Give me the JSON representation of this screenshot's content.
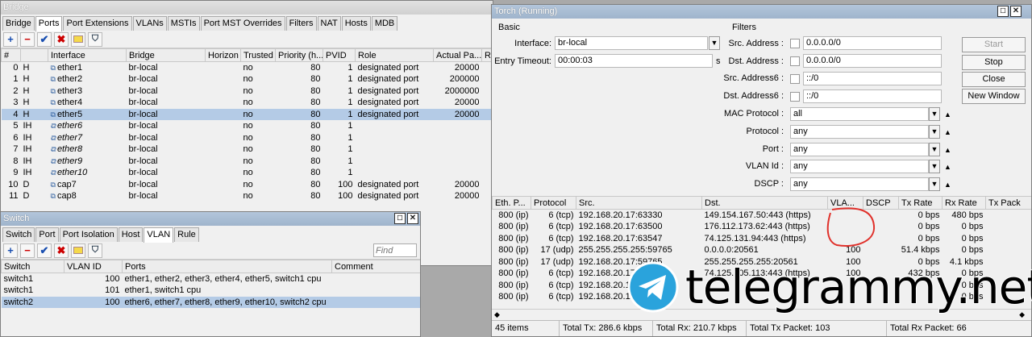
{
  "bridge": {
    "title": "Bridge",
    "tabs": [
      "Bridge",
      "Ports",
      "Port Extensions",
      "VLANs",
      "MSTIs",
      "Port MST Overrides",
      "Filters",
      "NAT",
      "Hosts",
      "MDB"
    ],
    "active_tab": "Ports",
    "columns": [
      "#",
      "",
      "Interface",
      "Bridge",
      "Horizon",
      "Trusted",
      "Priority (h...",
      "PVID",
      "Role",
      "Actual Pa...",
      "R"
    ],
    "rows": [
      {
        "num": "0",
        "flag": "H",
        "iface": "ether1",
        "bridge": "br-local",
        "horizon": "",
        "trusted": "no",
        "priority": "80",
        "pvid": "1",
        "role": "designated port",
        "cost": "20000",
        "italic": false
      },
      {
        "num": "1",
        "flag": "H",
        "iface": "ether2",
        "bridge": "br-local",
        "horizon": "",
        "trusted": "no",
        "priority": "80",
        "pvid": "1",
        "role": "designated port",
        "cost": "200000",
        "italic": false
      },
      {
        "num": "2",
        "flag": "H",
        "iface": "ether3",
        "bridge": "br-local",
        "horizon": "",
        "trusted": "no",
        "priority": "80",
        "pvid": "1",
        "role": "designated port",
        "cost": "2000000",
        "italic": false
      },
      {
        "num": "3",
        "flag": "H",
        "iface": "ether4",
        "bridge": "br-local",
        "horizon": "",
        "trusted": "no",
        "priority": "80",
        "pvid": "1",
        "role": "designated port",
        "cost": "20000",
        "italic": false
      },
      {
        "num": "4",
        "flag": "H",
        "iface": "ether5",
        "bridge": "br-local",
        "horizon": "",
        "trusted": "no",
        "priority": "80",
        "pvid": "1",
        "role": "designated port",
        "cost": "20000",
        "italic": false
      },
      {
        "num": "5",
        "flag": "IH",
        "iface": "ether6",
        "bridge": "br-local",
        "horizon": "",
        "trusted": "no",
        "priority": "80",
        "pvid": "1",
        "role": "",
        "cost": "",
        "italic": true
      },
      {
        "num": "6",
        "flag": "IH",
        "iface": "ether7",
        "bridge": "br-local",
        "horizon": "",
        "trusted": "no",
        "priority": "80",
        "pvid": "1",
        "role": "",
        "cost": "",
        "italic": true
      },
      {
        "num": "7",
        "flag": "IH",
        "iface": "ether8",
        "bridge": "br-local",
        "horizon": "",
        "trusted": "no",
        "priority": "80",
        "pvid": "1",
        "role": "",
        "cost": "",
        "italic": true
      },
      {
        "num": "8",
        "flag": "IH",
        "iface": "ether9",
        "bridge": "br-local",
        "horizon": "",
        "trusted": "no",
        "priority": "80",
        "pvid": "1",
        "role": "",
        "cost": "",
        "italic": true
      },
      {
        "num": "9",
        "flag": "IH",
        "iface": "ether10",
        "bridge": "br-local",
        "horizon": "",
        "trusted": "no",
        "priority": "80",
        "pvid": "1",
        "role": "",
        "cost": "",
        "italic": true
      },
      {
        "num": "10",
        "flag": "D",
        "iface": "cap7",
        "bridge": "br-local",
        "horizon": "",
        "trusted": "no",
        "priority": "80",
        "pvid": "100",
        "role": "designated port",
        "cost": "20000",
        "italic": false
      },
      {
        "num": "11",
        "flag": "D",
        "iface": "cap8",
        "bridge": "br-local",
        "horizon": "",
        "trusted": "no",
        "priority": "80",
        "pvid": "100",
        "role": "designated port",
        "cost": "20000",
        "italic": false
      }
    ],
    "selected_row": 4
  },
  "switch": {
    "title": "Switch",
    "tabs": [
      "Switch",
      "Port",
      "Port Isolation",
      "Host",
      "VLAN",
      "Rule"
    ],
    "active_tab": "VLAN",
    "find_placeholder": "Find",
    "columns": [
      "Switch",
      "VLAN ID",
      "Ports",
      "Comment"
    ],
    "rows": [
      {
        "switch": "switch1",
        "vlan": "100",
        "ports": "ether1, ether2, ether3, ether4, ether5, switch1 cpu"
      },
      {
        "switch": "switch1",
        "vlan": "101",
        "ports": "ether1, switch1 cpu"
      },
      {
        "switch": "switch2",
        "vlan": "100",
        "ports": "ether6, ether7, ether8, ether9, ether10, switch2 cpu"
      }
    ],
    "selected_row": 2
  },
  "torch": {
    "title": "Torch (Running)",
    "basic_label": "Basic",
    "filters_label": "Filters",
    "interface_label": "Interface:",
    "interface_value": "br-local",
    "entry_timeout_label": "Entry Timeout:",
    "entry_timeout_value": "00:00:03",
    "entry_timeout_unit": "s",
    "src_address_label": "Src. Address :",
    "src_address_value": "0.0.0.0/0",
    "dst_address_label": "Dst. Address :",
    "dst_address_value": "0.0.0.0/0",
    "src_address6_label": "Src. Address6 :",
    "src_address6_value": "::/0",
    "dst_address6_label": "Dst. Address6 :",
    "dst_address6_value": "::/0",
    "mac_protocol_label": "MAC Protocol :",
    "mac_protocol_value": "all",
    "protocol_label": "Protocol :",
    "protocol_value": "any",
    "port_label": "Port :",
    "port_value": "any",
    "vlan_id_label": "VLAN Id :",
    "vlan_id_value": "any",
    "dscp_label": "DSCP :",
    "dscp_value": "any",
    "buttons": {
      "start": "Start",
      "stop": "Stop",
      "close": "Close",
      "new_window": "New Window"
    },
    "columns": [
      "Eth. P...",
      "Protocol",
      "Src.",
      "Dst.",
      "VLA...",
      "DSCP",
      "Tx Rate",
      "Rx Rate",
      "Tx Pack"
    ],
    "rows": [
      {
        "eth": "800 (ip)",
        "proto": "6 (tcp)",
        "src": "192.168.20.17:63330",
        "dst": "149.154.167.50:443 (https)",
        "vlan": "",
        "dscp": "",
        "tx": "0 bps",
        "rx": "480 bps"
      },
      {
        "eth": "800 (ip)",
        "proto": "6 (tcp)",
        "src": "192.168.20.17:63500",
        "dst": "176.112.173.62:443 (https)",
        "vlan": "",
        "dscp": "",
        "tx": "0 bps",
        "rx": "0 bps"
      },
      {
        "eth": "800 (ip)",
        "proto": "6 (tcp)",
        "src": "192.168.20.17:63547",
        "dst": "74.125.131.94:443 (https)",
        "vlan": "",
        "dscp": "",
        "tx": "0 bps",
        "rx": "0 bps"
      },
      {
        "eth": "800 (ip)",
        "proto": "17 (udp)",
        "src": "255.255.255.255:59765",
        "dst": "0.0.0.0:20561",
        "vlan": "100",
        "dscp": "",
        "tx": "51.4 kbps",
        "rx": "0 bps"
      },
      {
        "eth": "800 (ip)",
        "proto": "17 (udp)",
        "src": "192.168.20.17:59765",
        "dst": "255.255.255.255:20561",
        "vlan": "100",
        "dscp": "",
        "tx": "0 bps",
        "rx": "4.1 kbps"
      },
      {
        "eth": "800 (ip)",
        "proto": "6 (tcp)",
        "src": "192.168.20.17",
        "dst": "74.125.105.113:443 (https)",
        "vlan": "100",
        "dscp": "",
        "tx": "432 bps",
        "rx": "0 bps"
      },
      {
        "eth": "800 (ip)",
        "proto": "6 (tcp)",
        "src": "192.168.20.17",
        "dst": "",
        "vlan": "",
        "dscp": "",
        "tx": "",
        "rx": "0 bps"
      },
      {
        "eth": "800 (ip)",
        "proto": "6 (tcp)",
        "src": "192.168.20.17",
        "dst": "",
        "vlan": "",
        "dscp": "",
        "tx": "",
        "rx": "0 bps"
      }
    ],
    "status": {
      "items": "45 items",
      "total_tx": "Total Tx: 286.6 kbps",
      "total_rx": "Total Rx: 210.7 kbps",
      "total_tx_packet": "Total Tx Packet: 103",
      "total_rx_packet": "Total Rx Packet: 66"
    }
  },
  "watermark": {
    "text": "telegrammy.net",
    "accent": "#2aa3dc"
  }
}
